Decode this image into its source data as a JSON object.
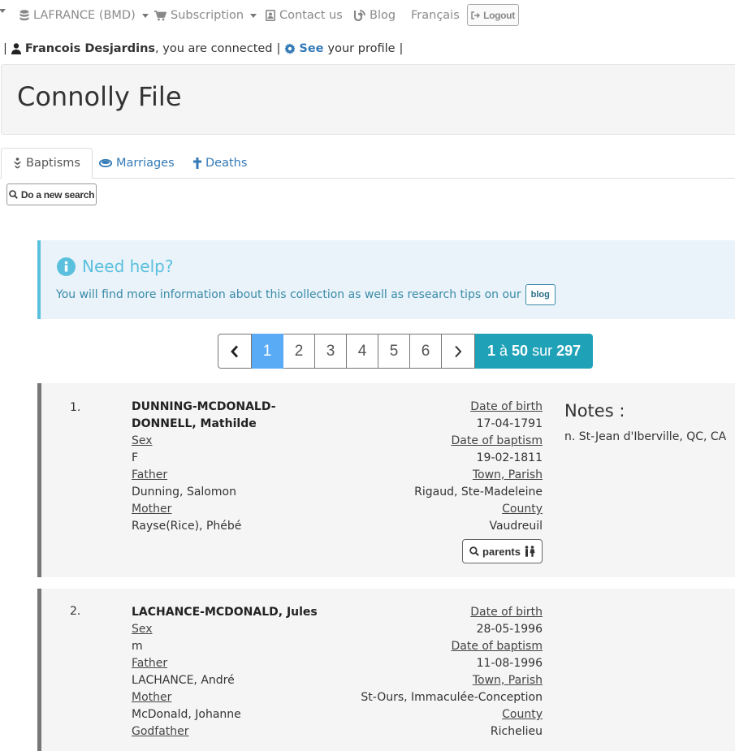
{
  "nav": {
    "account": "LAFRANCE (BMD)",
    "subscription": "Subscription",
    "contact": "Contact us",
    "blog": "Blog",
    "language": "Français",
    "logout": "Logout"
  },
  "user": {
    "name": "Francois Desjardins",
    "connected_text": ", you are connected",
    "see_label": "See",
    "profile_text": "your profile"
  },
  "header": {
    "title": "Connolly File"
  },
  "tabs": [
    {
      "label": "Baptisms",
      "active": true
    },
    {
      "label": "Marriages",
      "active": false
    },
    {
      "label": "Deaths",
      "active": false
    }
  ],
  "search_button": "Do a new search",
  "help": {
    "title": "Need help?",
    "text": "You will find more information about this collection as well as research tips on our",
    "button": "blog"
  },
  "pagination": {
    "pages": [
      "1",
      "2",
      "3",
      "4",
      "5",
      "6"
    ],
    "current": "1",
    "range_start": "1",
    "range_sep": "à",
    "range_end": "50",
    "total_sep": "sur",
    "total": "297"
  },
  "labels": {
    "sex": "Sex",
    "father": "Father",
    "mother": "Mother",
    "godfather": "Godfather",
    "date_of_birth": "Date of birth",
    "date_of_baptism": "Date of baptism",
    "town_parish": "Town, Parish",
    "county": "County",
    "notes": "Notes :",
    "parents_button": "parents"
  },
  "records": [
    {
      "number": "1.",
      "name_line1": "DUNNING-MCDONALD-",
      "name_line2": "DONNELL, Mathilde",
      "sex": "F",
      "father": "Dunning, Salomon",
      "mother": "Rayse(Rice), Phébé",
      "date_of_birth": "17-04-1791",
      "date_of_baptism": "19-02-1811",
      "town_parish": "Rigaud, Ste-Madeleine",
      "county": "Vaudreuil",
      "notes": "n. St-Jean d'Iberville, QC, CA"
    },
    {
      "number": "2.",
      "name_line1": "LACHANCE-MCDONALD, Jules",
      "sex": "m",
      "father": "LACHANCE, André",
      "mother": "McDonald, Johanne",
      "date_of_birth": "28-05-1996",
      "date_of_baptism": "11-08-1996",
      "town_parish": "St-Ours, Immaculée-Conception",
      "county": "Richelieu"
    }
  ],
  "colors": {
    "link": "#337ab7",
    "info": "#5bc0de",
    "page_active": "#5aabf5",
    "total_badge": "#1fa2b8"
  }
}
